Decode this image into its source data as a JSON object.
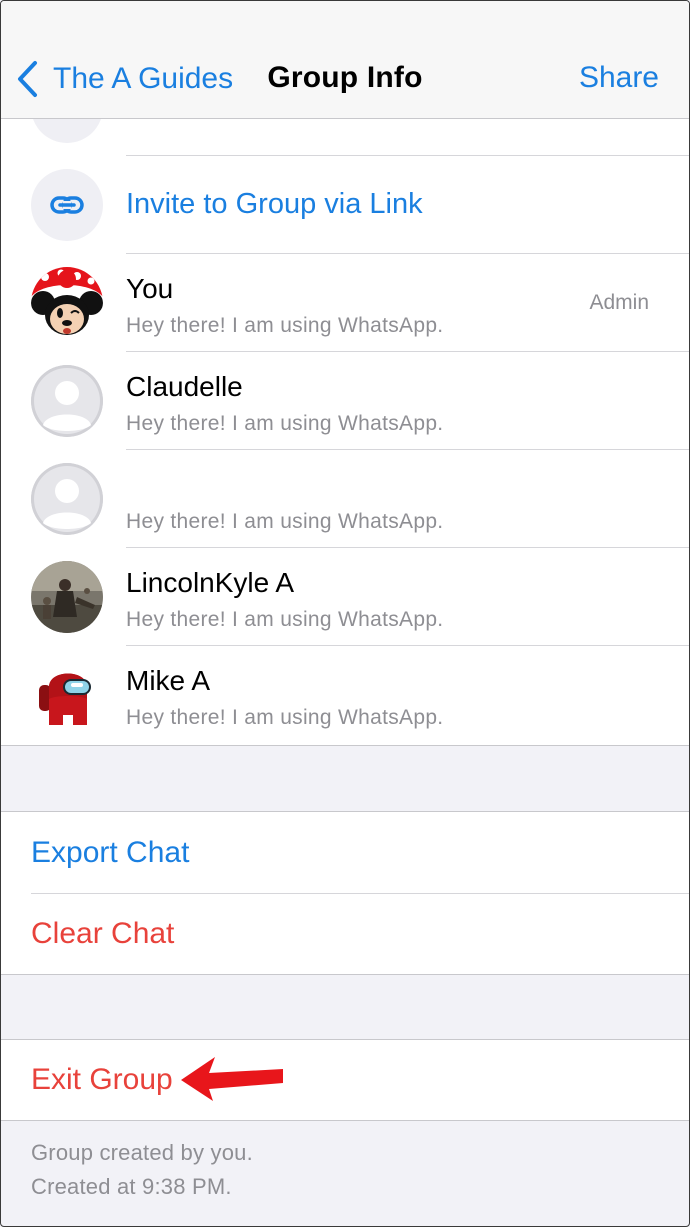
{
  "nav": {
    "back_label": "The A Guides",
    "title": "Group Info",
    "share_label": "Share"
  },
  "invite": {
    "label": "Invite to Group via Link",
    "icon": "link-icon"
  },
  "participants": [
    {
      "name": "You",
      "status": "Hey there! I am using WhatsApp.",
      "badge": "Admin",
      "avatar": "minnie-mouse-avatar"
    },
    {
      "name": "Claudelle",
      "status": "Hey there! I am using WhatsApp.",
      "avatar": "default-person-avatar"
    },
    {
      "name": "",
      "status": "Hey there! I am using WhatsApp.",
      "avatar": "default-person-avatar"
    },
    {
      "name": "LincolnKyle A",
      "status": "Hey there! I am using WhatsApp.",
      "avatar": "photo-avatar"
    },
    {
      "name": "Mike A",
      "status": "Hey there! I am using WhatsApp.",
      "avatar": "among-us-avatar"
    }
  ],
  "actions": {
    "export_chat": "Export Chat",
    "clear_chat": "Clear Chat",
    "exit_group": "Exit Group"
  },
  "footer": {
    "line1": "Group created by you.",
    "line2": "Created at 9:38 PM."
  },
  "colors": {
    "accent_blue": "#1a7fe0",
    "destructive_red": "#e8423b",
    "annotation_arrow": "#e8161b"
  }
}
